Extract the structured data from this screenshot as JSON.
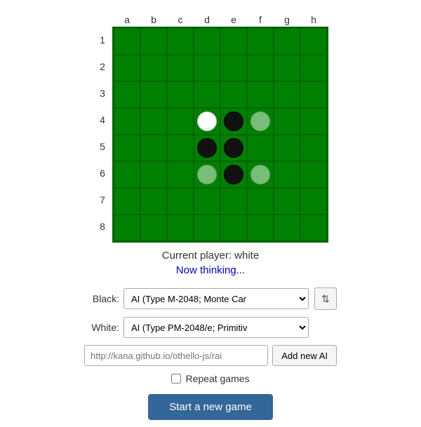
{
  "board": {
    "col_headers": [
      "a",
      "b",
      "c",
      "d",
      "e",
      "f",
      "g",
      "h"
    ],
    "row_headers": [
      "1",
      "2",
      "3",
      "4",
      "5",
      "6",
      "7",
      "8"
    ],
    "cells": [
      [
        "",
        "",
        "",
        "",
        "",
        "",
        "",
        ""
      ],
      [
        "",
        "",
        "",
        "",
        "",
        "",
        "",
        ""
      ],
      [
        "",
        "",
        "",
        "",
        "",
        "",
        "",
        ""
      ],
      [
        "",
        "",
        "",
        "W",
        "B",
        "G",
        "",
        ""
      ],
      [
        "",
        "",
        "",
        "B",
        "B",
        "",
        "",
        ""
      ],
      [
        "",
        "",
        "",
        "G",
        "B",
        "G",
        "",
        ""
      ],
      [
        "",
        "",
        "",
        "",
        "",
        "",
        "",
        ""
      ],
      [
        "",
        "",
        "",
        "",
        "",
        "",
        "",
        ""
      ]
    ]
  },
  "status": {
    "current_player_label": "Current player: white",
    "thinking_label": "Now thinking..."
  },
  "controls": {
    "black_label": "Black:",
    "white_label": "White:",
    "black_ai_value": "AI (Type M-2048; Monte Car",
    "white_ai_value": "AI (Type PM-2048/e; Primitiv",
    "swap_icon": "⇅",
    "url_placeholder": "http://kana.github.io/othello-js/rai",
    "add_ai_label": "Add new AI",
    "repeat_label": "Repeat games",
    "start_label": "Start a new game"
  },
  "colors": {
    "board_green": "#008000",
    "board_border": "#006600",
    "piece_black": "#111111",
    "piece_white": "#ffffff",
    "ghost": "rgba(200,230,200,0.6)",
    "status_blue": "#0000cc",
    "button_blue": "#336699"
  }
}
